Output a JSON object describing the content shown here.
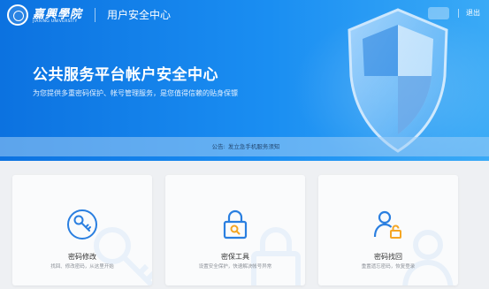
{
  "header": {
    "logo_text": "嘉興學院",
    "logo_subtext": "JIAXING UNIVERSITY",
    "app_title": "用户安全中心",
    "logout_label": "退出"
  },
  "hero": {
    "title": "公共服务平台帐户安全中心",
    "subtitle": "为您提供多重密码保护、帐号管理服务，是您值得信赖的贴身保镖"
  },
  "notice": {
    "label": "公告:",
    "text": "发立急手机服务须知"
  },
  "cards": [
    {
      "title": "密码修改",
      "desc": "找回、修改密码，从这里开始",
      "icon": "key-icon"
    },
    {
      "title": "密保工具",
      "desc": "设置安全保护，快速解决帐号异常",
      "icon": "lock-search-icon"
    },
    {
      "title": "密码找回",
      "desc": "重置遗忘密码，恢复登录",
      "icon": "user-unlock-icon"
    }
  ],
  "colors": {
    "primary": "#1a84ec",
    "icon_blue": "#2a7fe0",
    "icon_orange": "#f5a623"
  }
}
